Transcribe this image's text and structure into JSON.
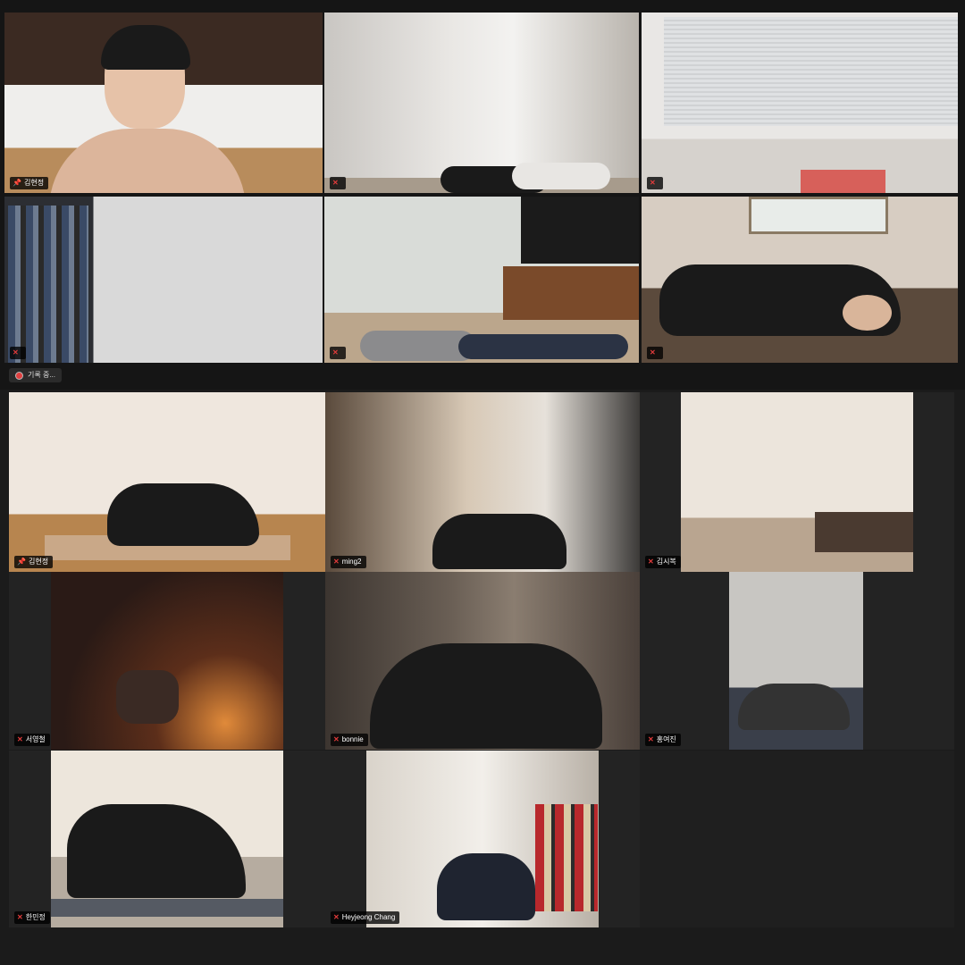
{
  "top_gallery": {
    "tiles": [
      {
        "name": "김현정",
        "pinned": true,
        "muted": false
      },
      {
        "name": "",
        "pinned": false,
        "muted": true
      },
      {
        "name": "",
        "pinned": false,
        "muted": true
      },
      {
        "name": "",
        "pinned": false,
        "muted": true
      },
      {
        "name": "",
        "pinned": false,
        "muted": true
      },
      {
        "name": "",
        "pinned": false,
        "muted": true
      }
    ],
    "recording_label": "기록 중..."
  },
  "bottom_gallery": {
    "tiles": [
      {
        "name": "김현정",
        "pinned": true,
        "muted": false
      },
      {
        "name": "ming2",
        "pinned": false,
        "muted": true
      },
      {
        "name": "김시복",
        "pinned": false,
        "muted": true
      },
      {
        "name": "서영철",
        "pinned": false,
        "muted": true
      },
      {
        "name": "bonnie",
        "pinned": false,
        "muted": true
      },
      {
        "name": "홍여진",
        "pinned": false,
        "muted": true
      },
      {
        "name": "한민정",
        "pinned": false,
        "muted": true
      },
      {
        "name": "Heyjeong Chang",
        "pinned": false,
        "muted": true
      }
    ]
  },
  "icons": {
    "pin": "pin-icon",
    "muted_mic": "muted-mic-icon",
    "record": "record-icon"
  },
  "colors": {
    "active_speaker_border": "#c9e07a",
    "muted_icon": "#e23b3b"
  }
}
